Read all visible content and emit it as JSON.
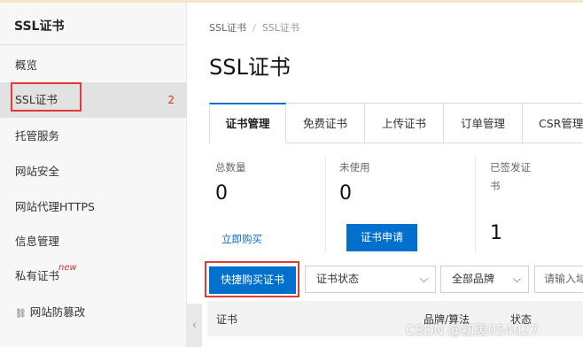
{
  "sidebar": {
    "title": "SSL证书",
    "items": [
      {
        "label": "概览"
      },
      {
        "label": "SSL证书",
        "badge": "2"
      },
      {
        "label": "托管服务"
      },
      {
        "label": "网站安全"
      },
      {
        "label": "网站代理HTTPS"
      },
      {
        "label": "信息管理"
      },
      {
        "label": "私有证书",
        "tag": "new"
      },
      {
        "label": "网站防篡改",
        "icon": "link-icon"
      }
    ],
    "collapse_icon": "‹"
  },
  "breadcrumb": {
    "items": [
      "SSL证书",
      "SSL证书"
    ],
    "separator": "/"
  },
  "page_title": "SSL证书",
  "tabs": [
    {
      "label": "证书管理",
      "active": true
    },
    {
      "label": "免费证书"
    },
    {
      "label": "上传证书"
    },
    {
      "label": "订单管理"
    },
    {
      "label": "CSR管理"
    }
  ],
  "stats": {
    "total": {
      "label": "总数量",
      "value": "0",
      "action": "立即购买"
    },
    "unused": {
      "label": "未使用",
      "value": "0",
      "action": "证书申请"
    },
    "issued": {
      "label_line1": "已签发证",
      "label_line2": "书",
      "value": "1"
    }
  },
  "toolbar": {
    "quick_buy": "快捷购买证书",
    "status_select": "证书状态",
    "brand_select": "全部品牌",
    "search_placeholder": "请输入域"
  },
  "table": {
    "columns": [
      "证书",
      "品牌/算法",
      "状态"
    ]
  },
  "watermark": "CSDN @初衷054027",
  "colors": {
    "accent": "#0070cc",
    "highlight_box": "#e53935",
    "badge": "#e0301e"
  }
}
